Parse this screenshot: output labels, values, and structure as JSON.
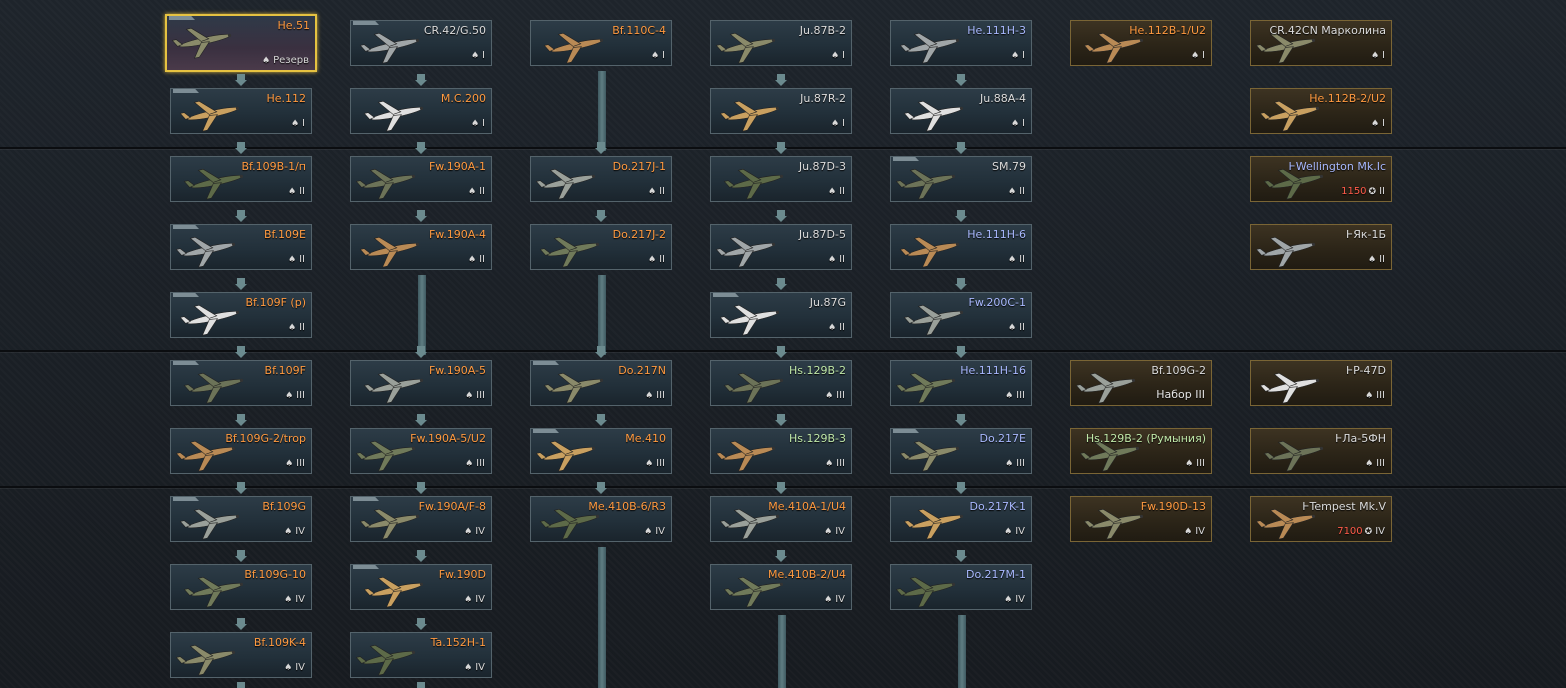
{
  "icons": {
    "research": "spade-icon",
    "currency": "eagle-icon"
  },
  "colors": {
    "selected_border": "#e6c241",
    "premium_border": "#7a6535",
    "name_orange": "#ff9a40",
    "cost_red": "#ff5b4a"
  },
  "columns": [
    [
      {
        "name": "He.51",
        "rank": "Резерв",
        "selected": true
      },
      {
        "name": "He.112",
        "rank": "I"
      },
      {
        "name": "Bf.109B-1/п",
        "rank": "II"
      },
      {
        "name": "Bf.109E",
        "rank": "II"
      },
      {
        "name": "Bf.109F (р)",
        "rank": "II"
      },
      {
        "name": "Bf.109F",
        "rank": "III"
      },
      {
        "name": "Bf.109G-2/trop",
        "rank": "III"
      },
      {
        "name": "Bf.109G",
        "rank": "IV"
      },
      {
        "name": "Bf.109G-10",
        "rank": "IV"
      },
      {
        "name": "Bf.109K-4",
        "rank": "IV"
      }
    ],
    [
      {
        "name": "CR.42/G.50",
        "rank": "I"
      },
      {
        "name": "M.C.200",
        "rank": "I"
      },
      {
        "name": "Fw.190A-1",
        "rank": "II"
      },
      {
        "name": "Fw.190A-4",
        "rank": "II"
      },
      {
        "name": "Fw.190A-5",
        "rank": "III"
      },
      {
        "name": "Fw.190A-5/U2",
        "rank": "III"
      },
      {
        "name": "Fw.190A/F-8",
        "rank": "IV"
      },
      {
        "name": "Fw.190D",
        "rank": "IV"
      },
      {
        "name": "Ta.152H-1",
        "rank": "IV"
      }
    ],
    [
      {
        "name": "Bf.110C-4",
        "rank": "I"
      },
      {
        "name": "Do.217J-1",
        "rank": "II"
      },
      {
        "name": "Do.217J-2",
        "rank": "II"
      },
      {
        "name": "Do.217N",
        "rank": "III"
      },
      {
        "name": "Me.410",
        "rank": "III"
      },
      {
        "name": "Me.410B-6/R3",
        "rank": "IV"
      }
    ],
    [
      {
        "name": "Ju.87B-2",
        "rank": "I"
      },
      {
        "name": "Ju.87R-2",
        "rank": "I"
      },
      {
        "name": "Ju.87D-3",
        "rank": "II"
      },
      {
        "name": "Ju.87D-5",
        "rank": "II"
      },
      {
        "name": "Ju.87G",
        "rank": "II"
      },
      {
        "name": "Hs.129B-2",
        "rank": "III"
      },
      {
        "name": "Hs.129B-3",
        "rank": "III"
      },
      {
        "name": "Me.410A-1/U4",
        "rank": "IV"
      },
      {
        "name": "Me.410B-2/U4",
        "rank": "IV"
      }
    ],
    [
      {
        "name": "He.111H-3",
        "rank": "I"
      },
      {
        "name": "Ju.88A-4",
        "rank": "I"
      },
      {
        "name": "SM.79",
        "rank": "II"
      },
      {
        "name": "He.111H-6",
        "rank": "II"
      },
      {
        "name": "Fw.200C-1",
        "rank": "II"
      },
      {
        "name": "He.111H-16",
        "rank": "III"
      },
      {
        "name": "Do.217E",
        "rank": "III"
      },
      {
        "name": "Do.217K-1",
        "rank": "IV"
      },
      {
        "name": "Do.217M-1",
        "rank": "IV"
      }
    ],
    [
      {
        "name": "He.112B-1/U2",
        "rank": "I",
        "premium": true
      },
      {
        "name": "Bf.109G-2",
        "note": "Набор III",
        "premium": true
      },
      {
        "name": "Hs.129B-2 (Румыния)",
        "rank": "III",
        "premium": true
      },
      {
        "name": "Fw.190D-13",
        "rank": "IV",
        "premium": true
      }
    ],
    [
      {
        "name": "CR.42CN Марколина",
        "rank": "I",
        "premium": true
      },
      {
        "name": "He.112B-2/U2",
        "rank": "I",
        "premium": true
      },
      {
        "name": "ⱵWellington Mk.Ic",
        "rank": "II",
        "cost": "1150",
        "premium": true
      },
      {
        "name": "ⱵЯк-1Б",
        "rank": "II",
        "premium": true
      },
      {
        "name": "ⱵP-47D",
        "rank": "III",
        "premium": true
      },
      {
        "name": "ⱵЛа-5ФН",
        "rank": "III",
        "premium": true
      },
      {
        "name": "ⱵTempest Mk.V",
        "rank": "IV",
        "cost": "7100",
        "premium": true
      }
    ]
  ]
}
